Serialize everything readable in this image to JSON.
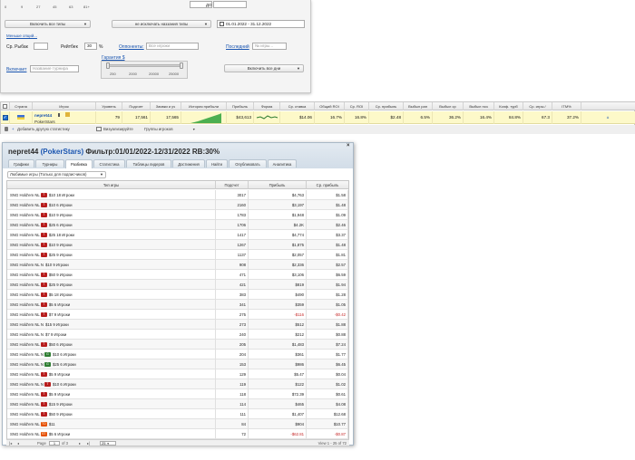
{
  "filter_panel": {
    "slider_scale": [
      "0",
      "9",
      "27",
      "45",
      "63",
      "81+"
    ],
    "to_label": "ДО",
    "game_types_dropdown": "Включить все типы",
    "game_names_dropdown": "не исключать наззания типы",
    "date_range": "01.01.2022 - 31.12.2022",
    "less_link": "Меньше опций...",
    "avg_fish_label": "Ср. Рыбак",
    "rating_label": "Рейтбек",
    "rating_value": "30",
    "percent": "%",
    "opponents_link": "Оппоненты:",
    "opponents_placeholder": "Все игроки",
    "last_link": "Последний",
    "last_placeholder": "№ игры...",
    "guarantee_link": "Гарантия $",
    "guarantee_scale": [
      "250",
      "2000",
      "20000",
      "25000"
    ],
    "include_link": "Включает",
    "tournament_placeholder": "Название турнира",
    "days_dropdown": "Включить все дни"
  },
  "grid": {
    "headers": [
      "Страна",
      "Игрок",
      "Уровень",
      "Подсчет",
      "Заявки и уч",
      "История прибыли",
      "Прибыль",
      "Форма",
      "Ср. ставка",
      "Общий ROI",
      "Ср. ROI",
      "Ср. прибыль",
      "Выбыл ран",
      "Выбыл ср",
      "Выбыл поз",
      "Коэф. турб",
      "Ср. игры /",
      "ITM%"
    ],
    "row": {
      "player_name": "nepret44",
      "network": "PokerStars",
      "level": "79",
      "count": "17,561",
      "entries": "17,565",
      "profit": "$43,613",
      "avg_stake": "$14.06",
      "total_roi": "16.7%",
      "avg_roi": "16.8%",
      "avg_profit": "$2.48",
      "early_out": "6.5%",
      "mid_out": "36.2%",
      "late_out": "16.4%",
      "turbo_coef": "84.8%",
      "avg_games": "67.3",
      "itm": "37.2%"
    },
    "footer": {
      "add_stats": "Добавить другую статистику",
      "visualize": "Визуализируйте",
      "player_groups": "Группы игроков"
    }
  },
  "window": {
    "player": "nepret44",
    "network": "(PokerStars)",
    "filter": "Фильтр:01/01/2022-12/31/2022 RB:30%",
    "tabs": [
      "Графики",
      "Турниры",
      "Разбивка",
      "Статистика",
      "Таблицы лидеров",
      "Достижения",
      "Найти",
      "Опубликовать",
      "Аналитика"
    ],
    "active_tab": 2,
    "breakdown_select": "Любимые игры (Только для подписчиков)",
    "columns": [
      "Тип игры",
      "Подсчет",
      "Прибыль",
      "Ср. прибыль"
    ],
    "rows": [
      {
        "name": "SNG Hold'em NL",
        "badge": "T",
        "suffix": "$10 18 Игроки",
        "count": "3017",
        "profit": "$4,763",
        "avg": "$1.58"
      },
      {
        "name": "SNG Hold'em NL",
        "badge": "T",
        "suffix": "$10 6 Игроки",
        "count": "2160",
        "profit": "$3,197",
        "avg": "$1.48"
      },
      {
        "name": "SNG Hold'em NL",
        "badge": "T",
        "suffix": "$10 9 Игроки",
        "count": "1783",
        "profit": "$1,948",
        "avg": "$1.09"
      },
      {
        "name": "SNG Hold'em NL",
        "badge": "T",
        "suffix": "$25 6 Игроки",
        "count": "1706",
        "profit": "$4.2K",
        "avg": "$2.46"
      },
      {
        "name": "SNG Hold'em NL",
        "badge": "T",
        "suffix": "$25 18 Игроки",
        "count": "1417",
        "profit": "$4,774",
        "avg": "$3.37"
      },
      {
        "name": "SNG Hold'em NL",
        "badge": "T",
        "suffix": "$10 9 Игроки",
        "count": "1267",
        "profit": "$1,875",
        "avg": "$1.48"
      },
      {
        "name": "SNG Hold'em NL",
        "badge": "T",
        "suffix": "$25 9 Игроки",
        "count": "1137",
        "profit": "$2,057",
        "avg": "$1.81"
      },
      {
        "name": "SNG Hold'em NL N",
        "badge": "",
        "suffix": "$10 9 Игроки",
        "count": "908",
        "profit": "$2,336",
        "avg": "$2.57"
      },
      {
        "name": "SNG Hold'em NL",
        "badge": "T",
        "suffix": "$50 9 Игроки",
        "count": "471",
        "profit": "$3,106",
        "avg": "$6.59"
      },
      {
        "name": "SNG Hold'em NL",
        "badge": "T",
        "suffix": "$25 9 Игроки",
        "count": "421",
        "profit": "$819",
        "avg": "$1.94"
      },
      {
        "name": "SNG Hold'em NL",
        "badge": "T",
        "suffix": "$5 18 Игроки",
        "count": "383",
        "profit": "$490",
        "avg": "$1.28"
      },
      {
        "name": "SNG Hold'em NL",
        "badge": "T",
        "suffix": "$5 6 Игроки",
        "count": "341",
        "profit": "$359",
        "avg": "$1.05"
      },
      {
        "name": "SNG Hold'em NL",
        "badge": "T",
        "suffix": "$7 9 Игроки",
        "count": "275",
        "profit": "-$116",
        "avg": "-$0.42"
      },
      {
        "name": "SNG Hold'em NL N",
        "badge": "",
        "suffix": "$15 9 Игроки",
        "count": "273",
        "profit": "$512",
        "avg": "$1.88"
      },
      {
        "name": "SNG Hold'em NL N",
        "badge": "",
        "suffix": "$7 9 Игроки",
        "count": "240",
        "profit": "$212",
        "avg": "$0.88"
      },
      {
        "name": "SNG Hold'em NL",
        "badge": "T",
        "suffix": "$50 6 Игроки",
        "count": "205",
        "profit": "$1,483",
        "avg": "$7.24"
      },
      {
        "name": "SNG Hold'em NL N",
        "badge": "G",
        "suffix": "$10 6 Игроки",
        "count": "204",
        "profit": "$361",
        "avg": "$1.77"
      },
      {
        "name": "SNG Hold'em NL N",
        "badge": "G",
        "suffix": "$25 6 Игроки",
        "count": "153",
        "profit": "$986",
        "avg": "$6.45"
      },
      {
        "name": "SNG Hold'em NL",
        "badge": "T",
        "suffix": "$5 9 Игроки",
        "count": "129",
        "profit": "$5.47",
        "avg": "$0.04"
      },
      {
        "name": "SNG Hold'em NL N",
        "badge": "T",
        "suffix": "$10 6 Игроки",
        "count": "119",
        "profit": "$122",
        "avg": "$1.02"
      },
      {
        "name": "SNG Hold'em NL",
        "badge": "T",
        "suffix": "$5 9 Игроки",
        "count": "118",
        "profit": "$72.39",
        "avg": "$0.61"
      },
      {
        "name": "SNG Hold'em NL",
        "badge": "T",
        "suffix": "$15 9 Игроки",
        "count": "114",
        "profit": "$465",
        "avg": "$4.08"
      },
      {
        "name": "SNG Hold'em NL",
        "badge": "T",
        "suffix": "$50 9 Игроки",
        "count": "111",
        "profit": "$1,407",
        "avg": "$12.68"
      },
      {
        "name": "SNG Hold'em NL",
        "badge": "TO",
        "suffix": "$11",
        "count": "84",
        "profit": "$904",
        "avg": "$10.77"
      },
      {
        "name": "SNG Hold'em NL",
        "badge": "ST",
        "suffix": "$5 6 Игроки",
        "count": "72",
        "profit": "-$62.81",
        "avg": "-$0.87"
      }
    ],
    "pager": {
      "page_label": "Page",
      "page": "1",
      "of": "of 3",
      "per_page": "25",
      "summary": "View 1 - 25 of 72"
    }
  }
}
